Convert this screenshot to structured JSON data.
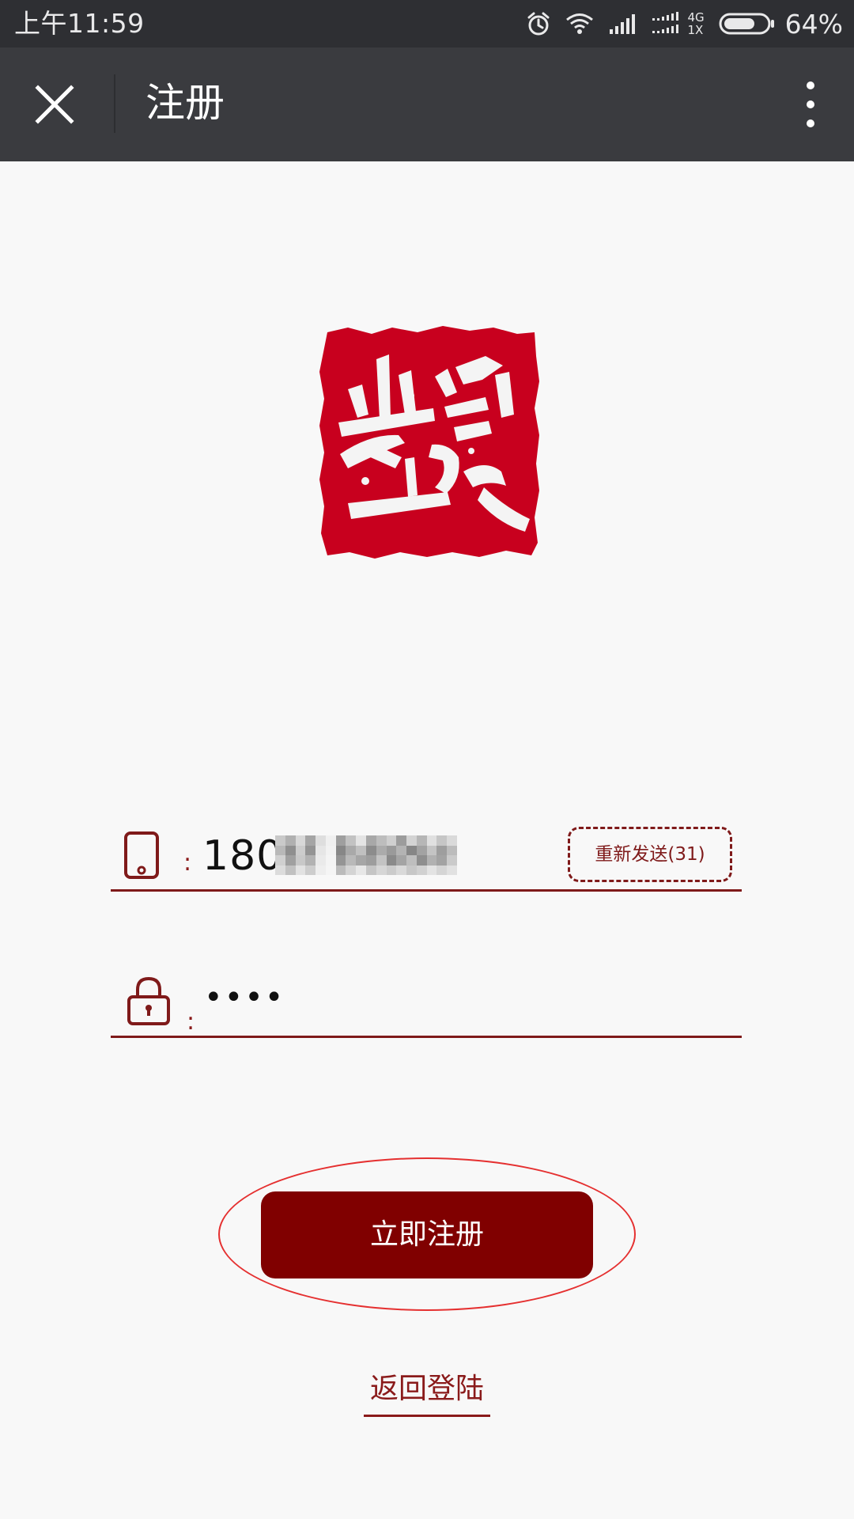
{
  "status_bar": {
    "time": "上午11:59",
    "network_top": "4G",
    "network_bottom": "1X",
    "battery_percent": "64%",
    "icons": [
      "alarm-icon",
      "wifi-icon",
      "signal-icon",
      "signal-icon",
      "battery-icon"
    ]
  },
  "title_bar": {
    "title": "注册",
    "close_icon": "close-icon",
    "more_icon": "more-vertical-icon"
  },
  "logo": {
    "type": "red-seal-stamp",
    "color": "#c8001e"
  },
  "form": {
    "phone": {
      "icon": "phone-icon",
      "colon": ":",
      "value_visible": "180",
      "resend_label": "重新发送(31)"
    },
    "code": {
      "icon": "lock-icon",
      "colon": ":",
      "masked_value": "••••"
    }
  },
  "actions": {
    "register_label": "立即注册",
    "back_login_label": "返回登陆"
  },
  "colors": {
    "primary": "#800000",
    "accent_text": "#8a1a1a",
    "highlight": "#e53030",
    "status_bar": "#2e2f33",
    "title_bar": "#3a3b3f",
    "background": "#f8f8f8"
  }
}
